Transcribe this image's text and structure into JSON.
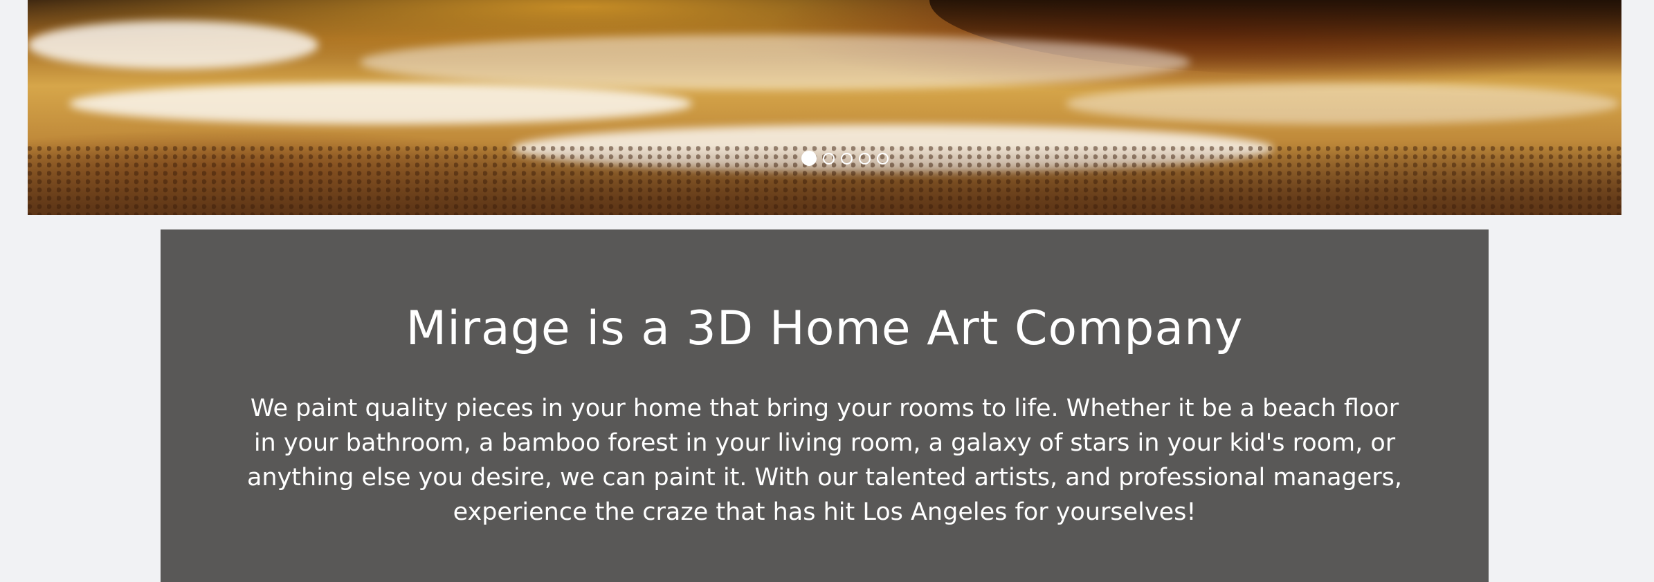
{
  "hero": {
    "image_icon": "beach-waves-photo",
    "carousel": {
      "slide_count": 5,
      "active_index": 0
    }
  },
  "intro": {
    "heading": "Mirage is a 3D Home Art Company",
    "body": "We paint quality pieces in your home that bring your rooms to life. Whether it be a beach floor in your bathroom, a bamboo forest in your living room, a galaxy of stars in your kid's room, or anything else you desire, we can paint it. With our talented artists, and professional managers, experience the craze that has hit Los Angeles for yourselves!"
  },
  "colors": {
    "page_background": "#f1f2f4",
    "panel_background": "#595857",
    "text": "#ffffff"
  }
}
